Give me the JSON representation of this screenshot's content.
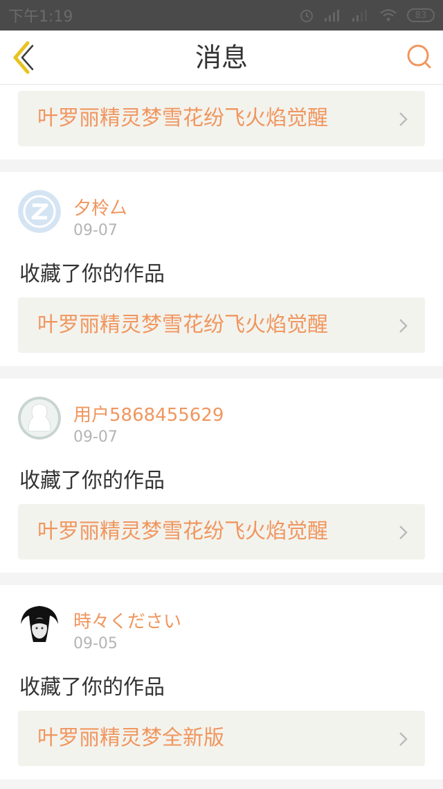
{
  "status_bar": {
    "time": "下午1:19",
    "battery": "83"
  },
  "header": {
    "title": "消息"
  },
  "partial_item": {
    "work_title": "叶罗丽精灵梦雪花纷飞火焰觉醒"
  },
  "messages": [
    {
      "user": "夕柃厶",
      "date": "09-07",
      "action": "收藏了你的作品",
      "work_title": "叶罗丽精灵梦雪花纷飞火焰觉醒"
    },
    {
      "user": "用户5868455629",
      "date": "09-07",
      "action": "收藏了你的作品",
      "work_title": "叶罗丽精灵梦雪花纷飞火焰觉醒"
    },
    {
      "user": "時々ください",
      "date": "09-05",
      "action": "收藏了你的作品",
      "work_title": "叶罗丽精灵梦全新版"
    }
  ],
  "colors": {
    "accent": "#f0965e",
    "back_icon": "#e8c21f"
  }
}
